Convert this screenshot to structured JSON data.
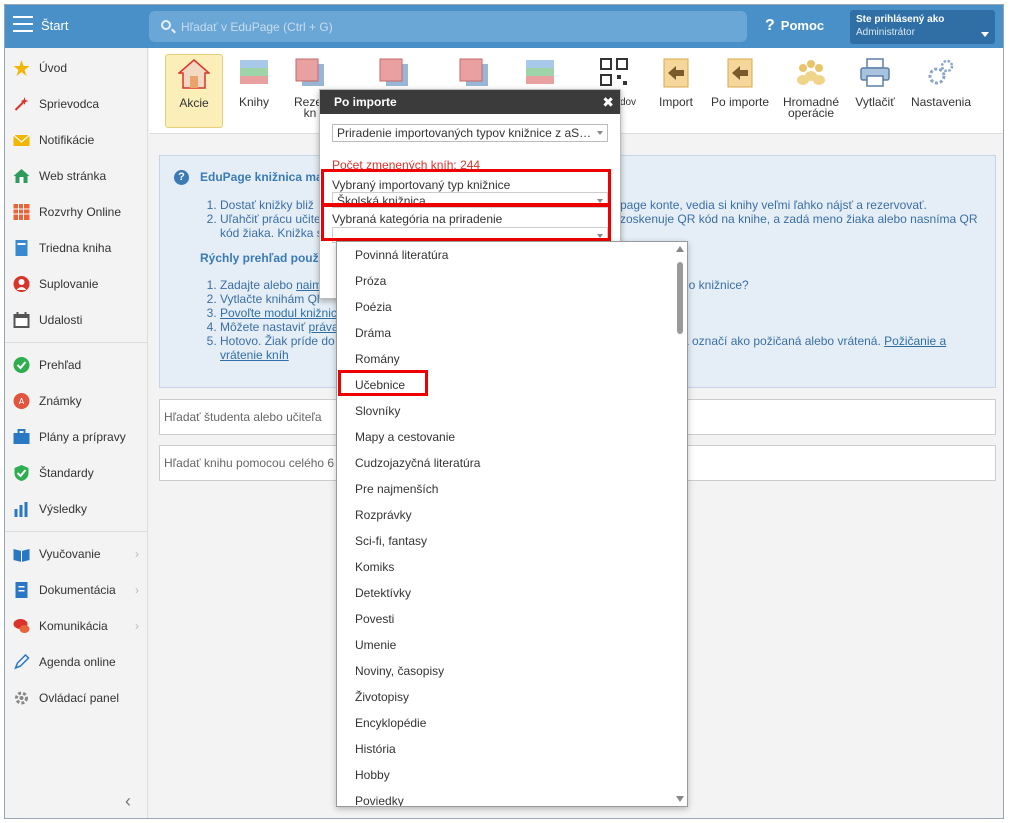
{
  "topbar": {
    "start_label": "Štart",
    "search_placeholder": "Hľadať v EduPage (Ctrl + G)",
    "help_label": "Pomoc",
    "user_line1": "Ste prihlásený ako",
    "user_line2": "Administrátor"
  },
  "sidebar": {
    "items": [
      {
        "label": "Úvod"
      },
      {
        "label": "Sprievodca"
      },
      {
        "label": "Notifikácie"
      },
      {
        "label": "Web stránka"
      },
      {
        "label": "Rozvrhy Online"
      },
      {
        "label": "Triedna kniha"
      },
      {
        "label": "Suplovanie"
      },
      {
        "label": "Udalosti"
      },
      {
        "label": "Prehľad"
      },
      {
        "label": "Známky"
      },
      {
        "label": "Plány a prípravy"
      },
      {
        "label": "Štandardy"
      },
      {
        "label": "Výsledky"
      },
      {
        "label": "Vyučovanie"
      },
      {
        "label": "Dokumentácia"
      },
      {
        "label": "Komunikácia"
      },
      {
        "label": "Agenda online"
      },
      {
        "label": "Ovládací panel"
      }
    ],
    "collapse_glyph": "‹"
  },
  "toolbar": {
    "akcie": "Akcie",
    "knihy": "Knihy",
    "rezerv_1": "Rezer",
    "rezerv_2": "kn",
    "dov": "dov",
    "import": "Import",
    "po_importe": "Po importe",
    "hromadne_1": "Hromadné",
    "hromadne_2": "operácie",
    "vytlacit": "Vytlačiť",
    "nastavenia": "Nastavenia"
  },
  "info": {
    "title": "EduPage knižnica ma",
    "list1": [
      "Dostať knižky bliž",
      "Uľahčiť prácu učite",
      "kód žiaka. Knižka s"
    ],
    "list1_right": [
      "page konte, vedia si knihy veľmi ľahko nájsť a rezervovať.",
      "zoskenuje QR kód na knihe, a zadá meno žiaka alebo nasníma QR"
    ],
    "subtitle": "Rýchly prehľad použ",
    "list2": [
      {
        "text": "Zadajte alebo ",
        "link": "naim"
      },
      {
        "text": "Vytlačte knihám Ql",
        "link": ""
      },
      {
        "text": "",
        "link": "Povoľte modul knižnic"
      },
      {
        "text": "Môžete nastaviť ",
        "link": "práva"
      },
      {
        "text": "Hotovo. Žiak príde do",
        "link": ""
      }
    ],
    "list2_cont_link": "vrátenie kníh",
    "list2_right_1": "do knižnice?",
    "list2_right_5_text": "a označí ako požičaná alebo vrátená. ",
    "list2_right_5_link": "Požičanie a"
  },
  "searches": {
    "student": "Hľadať študenta alebo učiteľa",
    "book": "Hľadať knihu pomocou celého 6"
  },
  "dialog": {
    "title": "Po importe",
    "close": "✖",
    "mode_select": "Priradenie importovaných typov knižnice z aS…",
    "count": "Počet zmenených kníh: 244",
    "type_label": "Vybraný importovaný typ knižnice",
    "type_value": "Školská knižnica",
    "category_label": "Vybraná kategória na priradenie",
    "category_value": ""
  },
  "dropdown": {
    "options": [
      "Povinná literatúra",
      "Próza",
      "Poézia",
      "Dráma",
      "Romány",
      "Učebnice",
      "Slovníky",
      "Mapy a cestovanie",
      "Cudzojazyčná literatúra",
      "Pre najmenších",
      "Rozprávky",
      "Sci-fi, fantasy",
      "Komiks",
      "Detektívky",
      "Povesti",
      "Umenie",
      "Noviny, časopisy",
      "Životopisy",
      "Encyklopédie",
      "História",
      "Hobby",
      "Poviedky"
    ],
    "highlighted": "Učebnice"
  },
  "colors": {
    "topbar": "#4a90c8",
    "dialog_title": "#3b3b3b",
    "highlight": "#ee0000",
    "active_tool": "#fbeeb8"
  }
}
